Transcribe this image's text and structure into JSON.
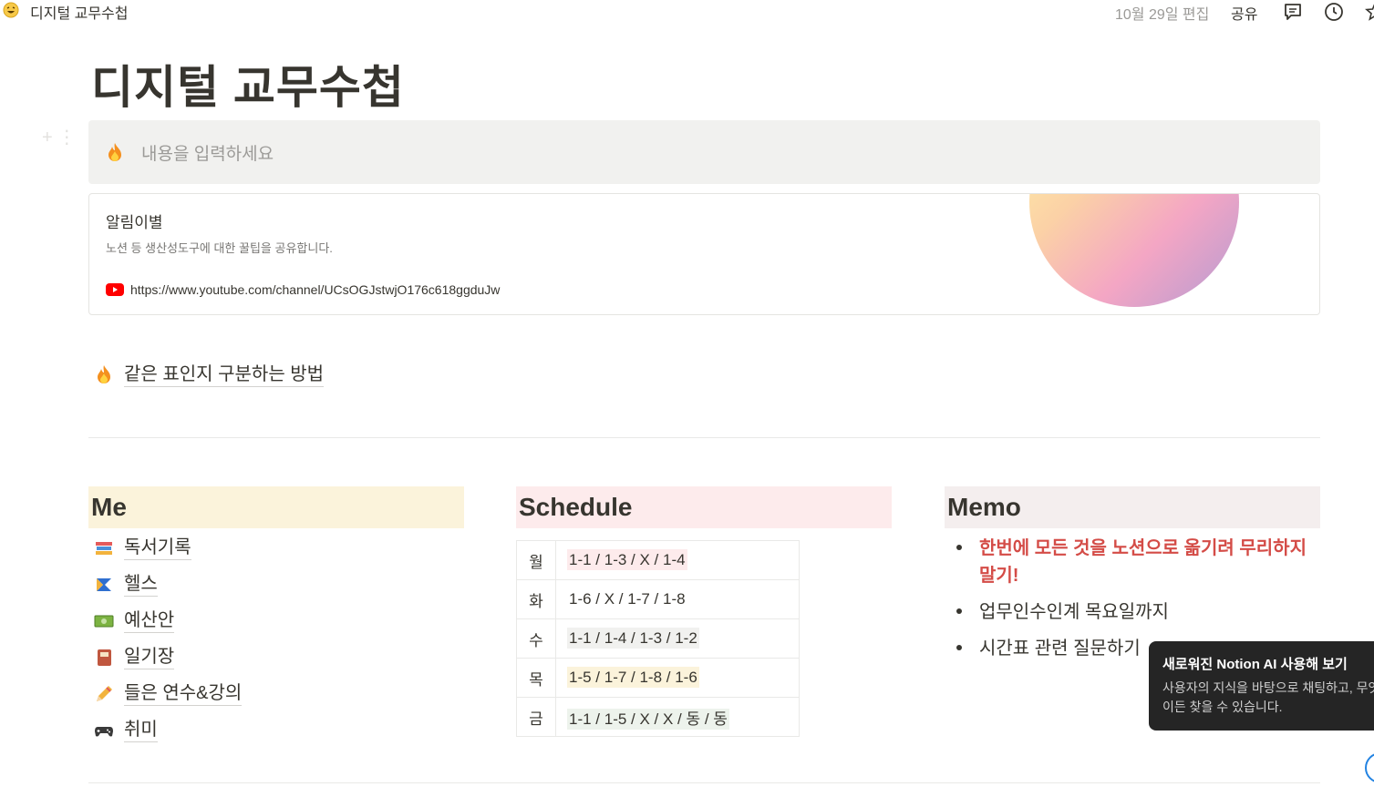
{
  "topbar": {
    "page_title": "디지털 교무수첩",
    "edited": "10월 29일 편집",
    "share": "공유",
    "icons": [
      "grin-emoji-icon",
      "comments-icon",
      "history-clock-icon",
      "star-icon"
    ]
  },
  "page": {
    "title": "디지털 교무수첩"
  },
  "callout": {
    "emoji": "fire-icon",
    "placeholder": "내용을 입력하세요"
  },
  "bookmark": {
    "title": "알림이별",
    "description": "노션 등 생산성도구에 대한 꿀팁을 공유합니다.",
    "url": "https://www.youtube.com/channel/UCsOGJstwjO176c618ggduJw",
    "favicon": "youtube-icon"
  },
  "link_page": {
    "emoji": "fire-icon",
    "label": "같은 표인지 구분하는 방법"
  },
  "columns": {
    "me": {
      "heading": "Me",
      "color": "#fbf3db",
      "items": [
        {
          "icon": "books-icon",
          "label": "독서기록"
        },
        {
          "icon": "sports-icon",
          "label": "헬스"
        },
        {
          "icon": "money-icon",
          "label": "예산안"
        },
        {
          "icon": "notebook-icon",
          "label": "일기장"
        },
        {
          "icon": "pencil-icon",
          "label": "들은 연수&강의"
        },
        {
          "icon": "gamepad-icon",
          "label": "취미"
        }
      ]
    },
    "schedule": {
      "heading": "Schedule",
      "color": "#fdebec",
      "rows": [
        {
          "day": "월",
          "value": "1-1 / 1-3 / X / 1-4",
          "bg": "#fdebec"
        },
        {
          "day": "화",
          "value": "1-6 / X / 1-7 / 1-8",
          "bg": "#ffffff"
        },
        {
          "day": "수",
          "value": "1-1 / 1-4 / 1-3 / 1-2",
          "bg": "#f1f1ef"
        },
        {
          "day": "목",
          "value": "1-5 / 1-7 / 1-8 / 1-6",
          "bg": "#fbf3db"
        },
        {
          "day": "금",
          "value": "1-1 / 1-5 / X / X / 동 / 동",
          "bg": "#edf3ec"
        }
      ]
    },
    "memo": {
      "heading": "Memo",
      "color": "#f4eeee",
      "items": [
        {
          "text": "한번에 모든 것을 노션으로 옮기려 무리하지 말기!",
          "style": "red"
        },
        {
          "text": "업무인수인계 목요일까지",
          "style": "normal"
        },
        {
          "text": "시간표 관련 질문하기",
          "style": "normal"
        }
      ]
    }
  },
  "tooltip": {
    "title": "새로워진 Notion AI 사용해 보기",
    "body": "사용자의 지식을 바탕으로 채팅하고, 무엇이든 찾을 수 있습니다."
  },
  "colors": {
    "text": "#37352f",
    "muted": "#9b9a97",
    "red": "#d44c47",
    "accent": "#2383e2"
  }
}
